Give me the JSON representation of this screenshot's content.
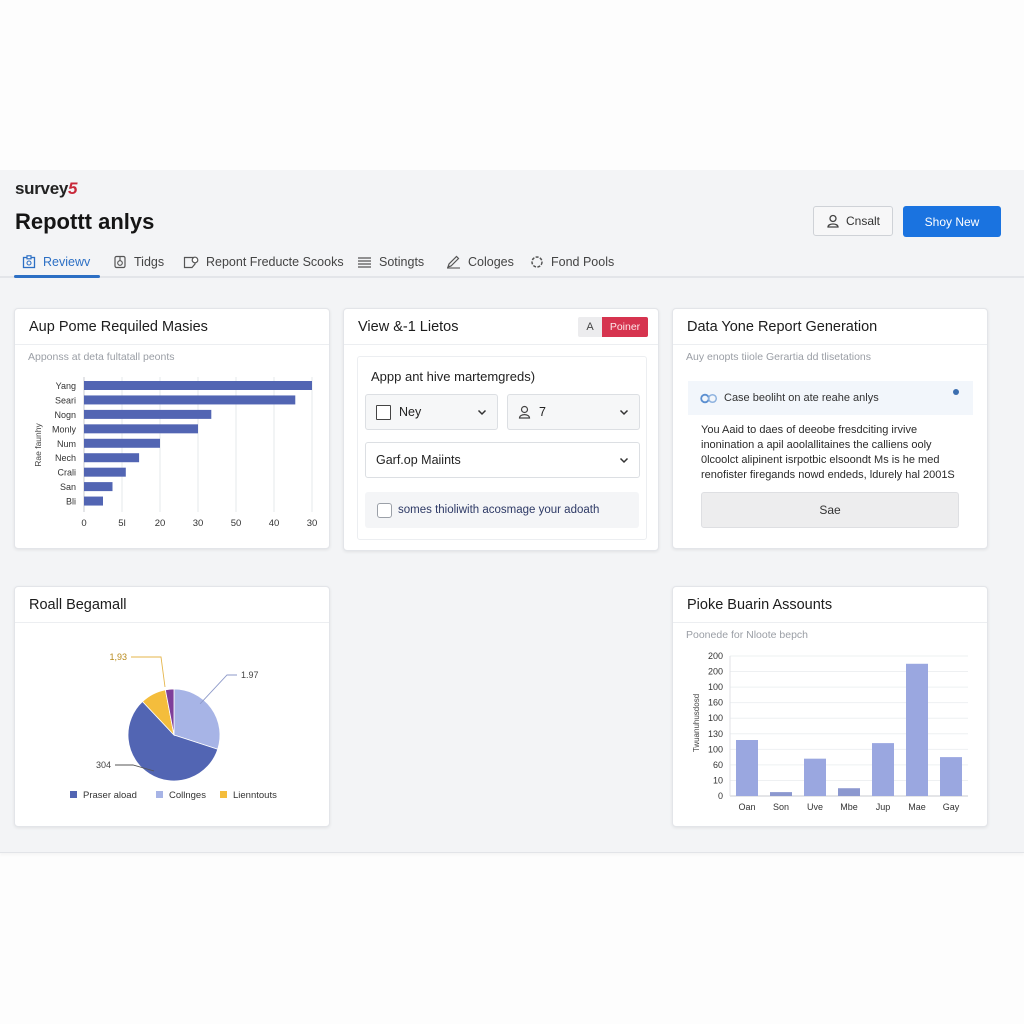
{
  "app": {
    "brand": "survey",
    "brand_accent": "5",
    "page_title": "Repottt anlys",
    "buttons": {
      "secondary": "Cnsalt",
      "primary": "Shoy New"
    }
  },
  "tabs": [
    {
      "label": "Reviewv",
      "icon": "clipboard-icon",
      "active": true
    },
    {
      "label": "Tidgs",
      "icon": "tag-icon",
      "active": false
    },
    {
      "label": "Repont Freducte Scooks",
      "icon": "report-icon",
      "active": false
    },
    {
      "label": "Sotingts",
      "icon": "list-icon",
      "active": false
    },
    {
      "label": "Cologes",
      "icon": "pencil-icon",
      "active": false
    },
    {
      "label": "Fond Pools",
      "icon": "gear-icon",
      "active": false
    }
  ],
  "cards": {
    "bar_card": {
      "title": "Aup Pome Requiled Masies",
      "subtitle": "Apponss at deta fultatall peonts"
    },
    "filters_card": {
      "title": "View &-1 Lietos",
      "badge_letter": "A",
      "badge_label": "Poiner",
      "prompt": "Appp ant hive martemgreds)",
      "select1": "Ney",
      "select2": "7",
      "select3": "Garf.op Maiints",
      "checkbox_label": "somes thioliwith acosmage your adoath",
      "checkbox_checked": false
    },
    "report_card": {
      "title": "Data Yone Report Generation",
      "subtitle": "Auy enopts tiiole Gerartia dd tlisetations",
      "notice": "Case beoliht on ate reahe anlys",
      "body": "You Aaid to daes of deeobe fresdciting irvive inonination a apil aoolallitaines the calliens ooly 0lcoolct alipinent isrpotbic elsoondt Ms is he med renofister firegands nowd endeds, ldurely hal 2001S",
      "button": "Sae"
    },
    "pie_card": {
      "title": "Roall Begamall"
    },
    "column_card": {
      "title": "Pioke Buarin Assounts",
      "subtitle": "Poonede for Nloote bepch"
    }
  },
  "colors": {
    "accent": "#1a73e0",
    "tab_active": "#2c6fc4",
    "bar_dark": "#5265b3",
    "bar_light": "#9aa7e0",
    "pie_light": "#a7b4e6",
    "pie_yellow": "#f4bd3c",
    "pie_purple": "#7e3e9a",
    "badge_red": "#d6344f"
  },
  "chart_data": [
    {
      "type": "bar",
      "orientation": "horizontal",
      "title": "Aup Pome Requiled Masies",
      "subtitle": "Apponss at deta fultatall peonts",
      "ylabel": "Rae faunhy",
      "xlabel": "",
      "categories": [
        "Yang",
        "Seari",
        "Nogn",
        "Monly",
        "Num",
        "Nech",
        "Crali",
        "San",
        "Bli"
      ],
      "values": [
        60,
        55.6,
        33.5,
        30,
        20,
        14.5,
        11,
        7.5,
        5
      ],
      "xlim": [
        0,
        60
      ],
      "x_tick_labels": [
        "0",
        "5l",
        "20",
        "30",
        "50",
        "40",
        "30"
      ],
      "grid": true
    },
    {
      "type": "pie",
      "title": "Roall Begamall",
      "slices": [
        {
          "name": "Collnges",
          "value": 30,
          "label": "1.97"
        },
        {
          "name": "Praser aload",
          "value": 58,
          "label": "304"
        },
        {
          "name": "Lienntouts",
          "value": 9,
          "label": "1,93"
        },
        {
          "name": "",
          "value": 3,
          "label": ""
        }
      ],
      "legend": [
        "Praser aload",
        "Collnges",
        "Lienntouts"
      ],
      "legend_position": "bottom"
    },
    {
      "type": "bar",
      "orientation": "vertical",
      "title": "Pioke Buarin Assounts",
      "subtitle": "Poonede for Nloote bepch",
      "ylabel": "Twuanuhusdosd",
      "categories": [
        "Oan",
        "Son",
        "Uve",
        "Mbe",
        "Jup",
        "Mae",
        "Gay"
      ],
      "values": [
        3.6,
        0.25,
        2.4,
        0.5,
        3.4,
        8.5,
        2.5
      ],
      "ylim": [
        0,
        9
      ],
      "y_tick_labels": [
        "0",
        "10",
        "60",
        "100",
        "130",
        "100",
        "160",
        "100",
        "200",
        "200"
      ],
      "grid": true
    }
  ]
}
